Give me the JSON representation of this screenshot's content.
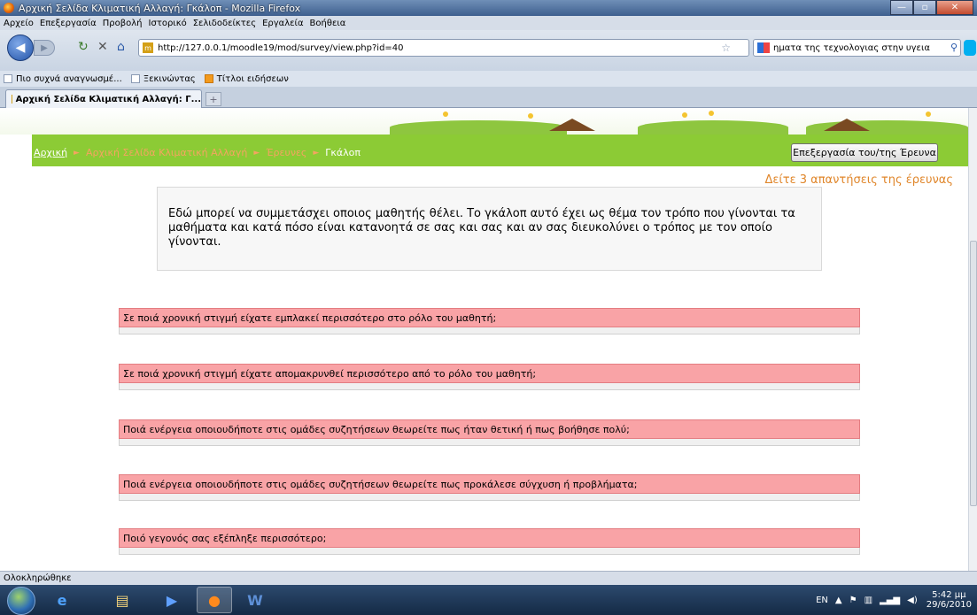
{
  "window": {
    "title": "Αρχική Σελίδα Κλιματική Αλλαγή: Γκάλοπ - Mozilla Firefox",
    "minimize": "—",
    "maximize": "▫",
    "close": "✕"
  },
  "menu": [
    "Αρχείο",
    "Επεξεργασία",
    "Προβολή",
    "Ιστορικό",
    "Σελιδοδείκτες",
    "Εργαλεία",
    "Βοήθεια"
  ],
  "nav": {
    "url": "http://127.0.0.1/moodle19/mod/survey/view.php?id=40",
    "search_text": "ηματα της τεχνολογιας στην υγεια"
  },
  "bookmarks": [
    "Πιο συχνά αναγνωσμέ...",
    "Ξεκινώντας",
    "Τίτλοι ειδήσεων"
  ],
  "tab": {
    "label": "Αρχική Σελίδα Κλιματική Αλλαγή: Γ...",
    "new_tab": "+"
  },
  "breadcrumb": {
    "home": "Αρχική",
    "course": "Αρχική Σελίδα Κλιματική Αλλαγή",
    "section": "Έρευνες",
    "current": "Γκάλοπ",
    "separator": "►"
  },
  "edit_button": "Επεξεργασία του/της Έρευνα",
  "responses_link": "Δείτε 3 απαντήσεις της έρευνας",
  "intro": "Εδώ μπορεί να συμμετάσχει οποιος μαθητής θέλει. Το γκάλοπ αυτό έχει ως θέμα τον τρόπο που γίνονται τα μαθήματα και κατά πόσο είναι κατανοητά σε σας και σας και αν σας διευκολύνει ο τρόπος με τον οποίο γίνονται.",
  "questions": [
    "Σε ποιά χρονική στιγμή είχατε εμπλακεί περισσότερο στο ρόλο του μαθητή;",
    "Σε ποιά χρονική στιγμή είχατε απομακρυνθεί περισσότερο από το ρόλο του μαθητή;",
    "Ποιά ενέργεια οποιουδήποτε στις ομάδες συζητήσεων θεωρείτε πως ήταν θετική ή πως βοήθησε πολύ;",
    "Ποιά ενέργεια οποιουδήποτε στις ομάδες συζητήσεων θεωρείτε πως προκάλεσε σύγχυση ή προβλήματα;",
    "Ποιό γεγονός σας εξέπληξε περισσότερο;"
  ],
  "status": "Ολοκληρώθηκε",
  "taskbar": {
    "lang": "EN",
    "time": "5:42 μμ",
    "date": "29/6/2010"
  },
  "colors": {
    "green_bar": "#8ccb35",
    "question_header": "#f9a3a6",
    "breadcrumb_link": "#f4a460",
    "responses_link": "#e0862a"
  }
}
